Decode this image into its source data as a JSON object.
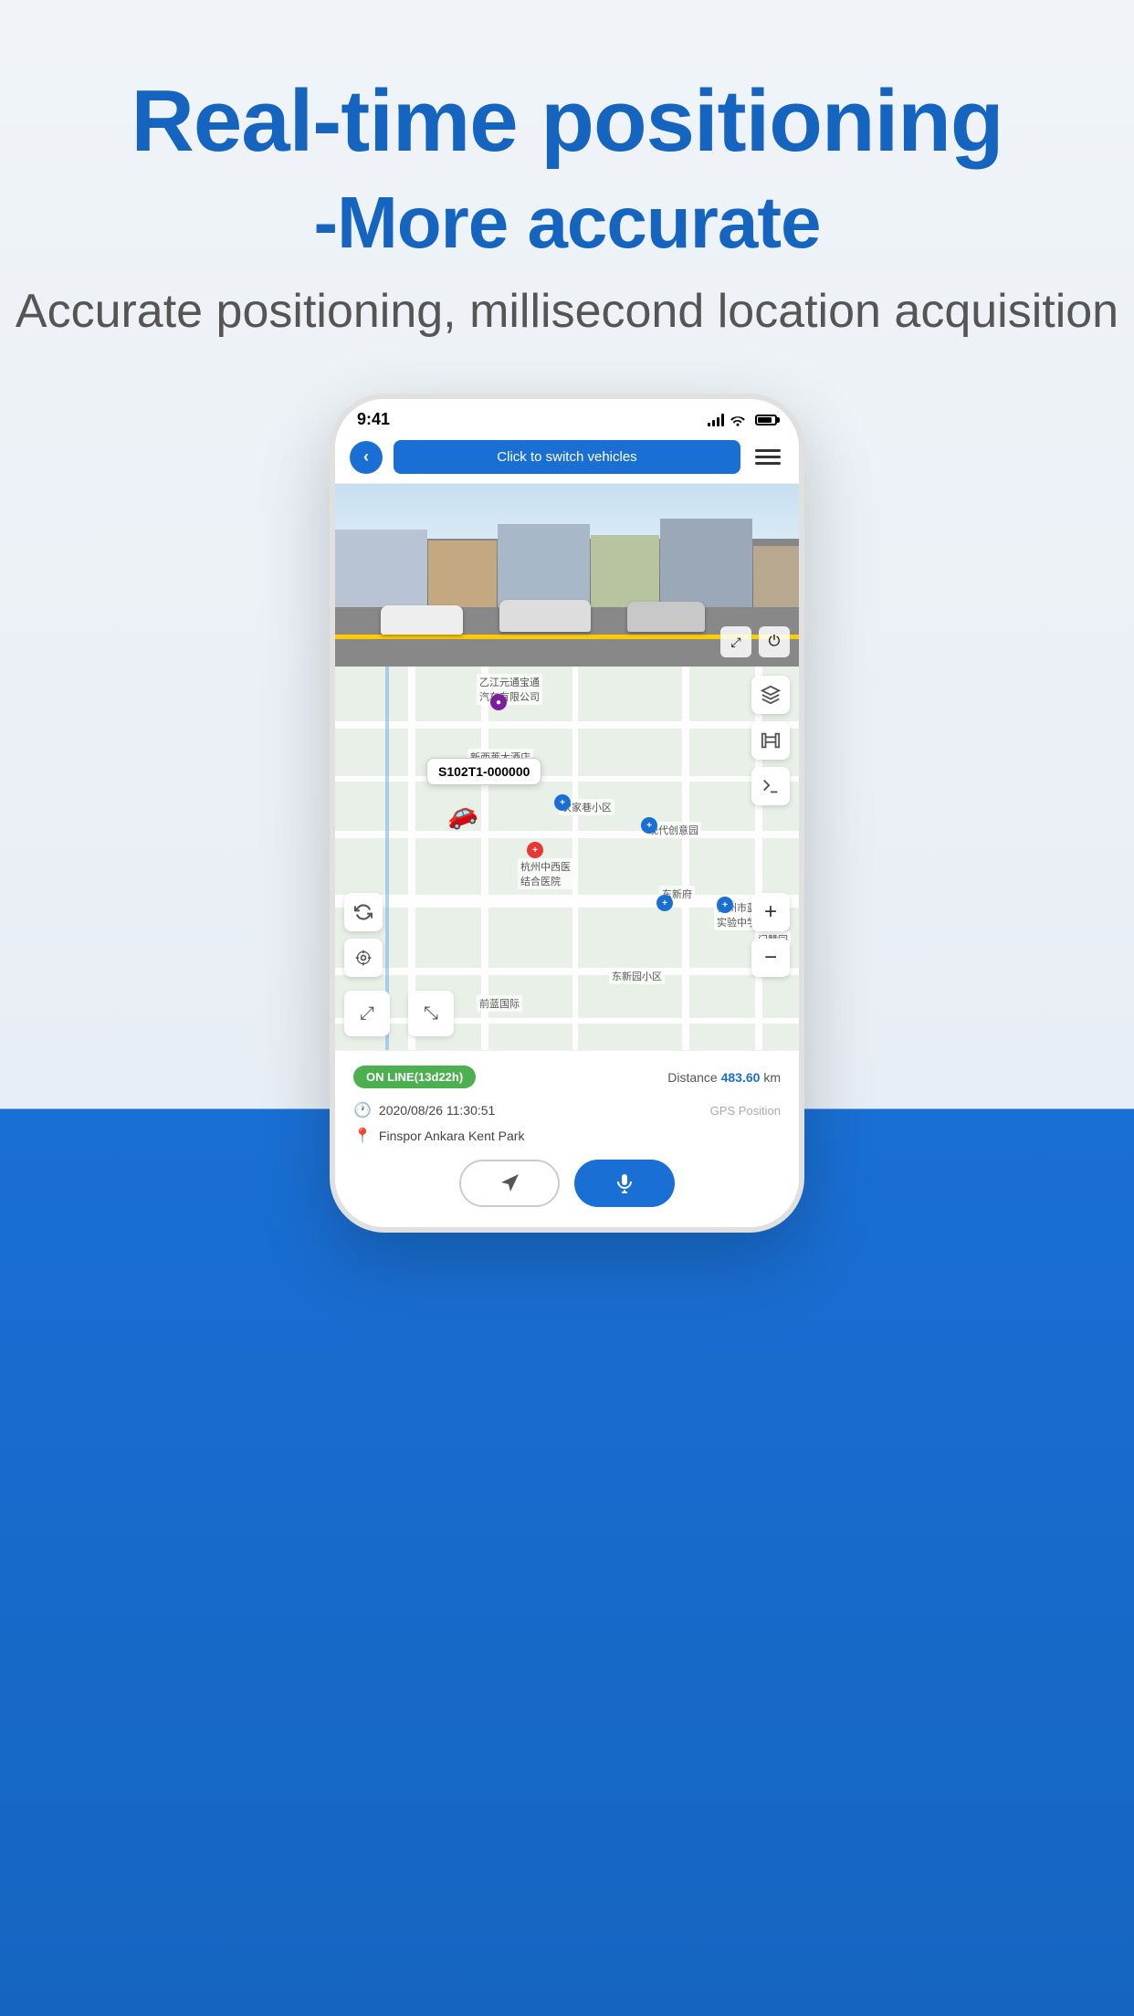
{
  "header": {
    "title_line1": "Real-time positioning",
    "title_line2": "-More accurate",
    "subtitle": "Accurate positioning, millisecond location acquisition"
  },
  "status_bar": {
    "time": "9:41",
    "signal": "signal",
    "wifi": "wifi",
    "battery": "battery"
  },
  "nav": {
    "back_label": "‹",
    "switch_vehicles_label": "Click to switch vehicles",
    "menu_label": "menu"
  },
  "map": {
    "vehicle_id": "S102T1-000000",
    "vehicle_icon": "🚗",
    "controls": {
      "layers_icon": "layers",
      "map_icon": "map",
      "terminal_icon": "terminal",
      "zoom_in": "+",
      "zoom_out": "−",
      "refresh_icon": "↻",
      "location_icon": "◎",
      "expand1_icon": "⤢",
      "expand2_icon": "⤡"
    }
  },
  "info_panel": {
    "status_badge": "ON LINE(13d22h)",
    "distance_label": "Distance",
    "distance_value": "483.60",
    "distance_unit": "km",
    "datetime": "2020/08/26 11:30:51",
    "gps_label": "GPS Position",
    "location": "Finspor Ankara Kent Park",
    "action_navigate_label": "navigate",
    "action_mic_label": "mic"
  },
  "street_view": {
    "expand_icon": "⤢",
    "power_icon": "⏻"
  }
}
